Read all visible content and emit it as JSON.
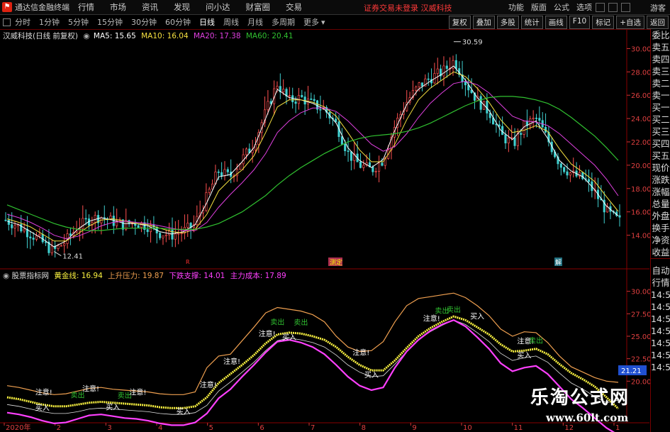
{
  "window": {
    "app_title": "通达信金融终端",
    "guest": "游客"
  },
  "menu": [
    "行情",
    "市场",
    "资讯",
    "发现",
    "问小达",
    "财富圈",
    "交易"
  ],
  "notice": "证券交易未登录  汉威科技",
  "right_menu": [
    "功能",
    "版面",
    "公式",
    "选项"
  ],
  "periods": [
    "分时",
    "1分钟",
    "5分钟",
    "15分钟",
    "30分钟",
    "60分钟",
    "日线",
    "周线",
    "月线",
    "多周期",
    "更多"
  ],
  "active_period": "日线",
  "toolbar_right": [
    "复权",
    "叠加",
    "多股",
    "统计",
    "画线",
    "F10",
    "标记",
    "+自选",
    "返回"
  ],
  "main_legend": {
    "stock": "汉威科技(日线 前复权)",
    "ma5": "MA5: 15.65",
    "ma10": "MA10: 16.04",
    "ma20": "MA20: 17.38",
    "ma60": "MA60: 20.41"
  },
  "main_axis": [
    "30.00",
    "28.00",
    "26.00",
    "24.00",
    "22.00",
    "20.00",
    "18.00",
    "16.00",
    "14.00"
  ],
  "main_annotations": {
    "high": "30.59",
    "low": "12.41"
  },
  "sub_legend": {
    "name": "股票指标网",
    "gold": "黄金线: 16.94",
    "up": "上升压力: 19.87",
    "down": "下跌支撑: 14.01",
    "cost": "主力成本: 17.89"
  },
  "sub_axis": [
    "30.00",
    "27.50",
    "25.00",
    "22.50",
    "20.00"
  ],
  "sub_price_tag": "21.21",
  "signals": {
    "attention": "注意!",
    "buy": "买入",
    "sell": "卖出"
  },
  "date_axis": [
    "2020年",
    "2",
    "3",
    "4",
    "5",
    "6",
    "7",
    "8",
    "9",
    "10",
    "11",
    "12",
    "1"
  ],
  "right_sidebar": [
    "委比",
    "卖五",
    "卖四",
    "卖三",
    "卖二",
    "卖一",
    "买一",
    "买二",
    "买三",
    "买四",
    "买五",
    "现价",
    "涨跌",
    "涨幅",
    "总量",
    "外盘",
    "换手",
    "净资",
    "收益",
    "",
    "自动",
    "行情",
    "14:5",
    "14:5",
    "14:5",
    "14:5",
    "14:5",
    "14:5",
    "14:5"
  ],
  "markers": {
    "r": "R",
    "yellow": "测定",
    "teal": "解"
  },
  "watermark": {
    "cn": "乐淘公式网",
    "url": "www.60lt.com"
  },
  "colors": {
    "ma5": "#ffffff",
    "ma10": "#f5e040",
    "ma20": "#e040e0",
    "ma60": "#30c030",
    "up_candle": "#ff5050",
    "down_candle": "#40d0d0",
    "gold": "#f8f040",
    "pressure": "#f0a050",
    "support": "#ff40ff",
    "cost": "#e0e0e0"
  },
  "chart_data": [
    {
      "type": "candlestick",
      "title": "",
      "ylim": [
        13,
        31
      ],
      "x": [
        "2020年",
        "2",
        "3",
        "4",
        "5",
        "6",
        "7",
        "8",
        "9",
        "10",
        "11",
        "12",
        "1"
      ],
      "close_path": [
        15.3,
        14.8,
        14.2,
        13.5,
        12.6,
        13.4,
        14.6,
        15.3,
        15.6,
        15.2,
        14.9,
        15.1,
        14.8,
        14.2,
        14.0,
        14.3,
        14.9,
        17.2,
        19.5,
        19.0,
        20.5,
        21.8,
        24.5,
        27.0,
        25.5,
        25.8,
        25.2,
        24.8,
        23.5,
        21.0,
        20.0,
        19.6,
        20.5,
        23.5,
        25.5,
        26.8,
        27.5,
        28.0,
        29.0,
        27.0,
        25.5,
        24.5,
        22.5,
        21.8,
        23.5,
        24.0,
        22.0,
        20.0,
        19.2,
        18.8,
        17.5,
        15.9,
        15.2
      ],
      "series": [
        {
          "name": "MA5",
          "values": [
            15.2,
            14.9,
            14.3,
            13.7,
            13.0,
            13.5,
            14.5,
            15.2,
            15.5,
            15.3,
            15.0,
            15.0,
            14.8,
            14.3,
            14.1,
            14.3,
            14.9,
            16.8,
            19.0,
            19.2,
            20.3,
            21.5,
            24.0,
            26.5,
            25.8,
            25.6,
            25.3,
            24.8,
            23.6,
            21.5,
            20.4,
            19.8,
            20.5,
            23.0,
            25.2,
            26.5,
            27.2,
            27.8,
            28.5,
            27.3,
            25.8,
            24.7,
            23.0,
            22.2,
            23.3,
            23.8,
            22.3,
            20.4,
            19.5,
            19.0,
            17.9,
            16.5,
            15.65
          ]
        },
        {
          "name": "MA10",
          "values": [
            15.4,
            15.1,
            14.7,
            14.1,
            13.5,
            13.5,
            14.1,
            14.8,
            15.3,
            15.4,
            15.2,
            15.0,
            14.9,
            14.6,
            14.3,
            14.2,
            14.5,
            15.8,
            17.8,
            18.8,
            19.6,
            20.8,
            22.8,
            25.0,
            25.6,
            25.6,
            25.4,
            25.0,
            24.2,
            22.8,
            21.3,
            20.3,
            20.3,
            21.8,
            23.9,
            25.6,
            26.6,
            27.3,
            28.0,
            27.6,
            26.6,
            25.4,
            23.9,
            22.8,
            23.0,
            23.4,
            22.9,
            21.4,
            20.1,
            19.4,
            18.6,
            17.3,
            16.04
          ]
        },
        {
          "name": "MA20",
          "values": [
            15.8,
            15.5,
            15.1,
            14.6,
            14.0,
            13.7,
            13.9,
            14.3,
            14.8,
            15.1,
            15.2,
            15.1,
            15.0,
            14.8,
            14.6,
            14.4,
            14.4,
            15.1,
            16.4,
            17.5,
            18.5,
            19.6,
            21.0,
            22.8,
            23.8,
            24.5,
            24.9,
            24.9,
            24.6,
            23.8,
            22.8,
            21.8,
            21.2,
            21.6,
            22.7,
            24.1,
            25.3,
            26.2,
            27.0,
            27.2,
            26.9,
            26.2,
            25.2,
            24.2,
            23.8,
            23.7,
            23.4,
            22.7,
            21.8,
            20.9,
            20.0,
            18.8,
            17.38
          ]
        },
        {
          "name": "MA60",
          "values": [
            16.6,
            16.2,
            15.8,
            15.4,
            15.0,
            14.7,
            14.5,
            14.4,
            14.4,
            14.5,
            14.6,
            14.6,
            14.6,
            14.6,
            14.5,
            14.5,
            14.5,
            14.7,
            15.0,
            15.5,
            16.0,
            16.7,
            17.4,
            18.3,
            19.1,
            19.8,
            20.4,
            21.0,
            21.5,
            22.0,
            22.3,
            22.5,
            22.6,
            22.7,
            22.9,
            23.2,
            23.6,
            24.1,
            24.6,
            25.1,
            25.5,
            25.8,
            25.9,
            25.9,
            25.8,
            25.6,
            25.3,
            24.8,
            24.1,
            23.3,
            22.5,
            21.5,
            20.41
          ]
        }
      ]
    },
    {
      "type": "line",
      "title": "股票指标网",
      "ylim": [
        16,
        31
      ],
      "series": [
        {
          "name": "黄金线",
          "values": [
            18.2,
            18.0,
            17.7,
            17.4,
            17.2,
            17.2,
            17.4,
            17.6,
            17.7,
            17.6,
            17.5,
            17.4,
            17.3,
            17.1,
            17.0,
            17.0,
            17.2,
            18.2,
            19.8,
            20.8,
            21.8,
            22.9,
            24.2,
            25.2,
            25.4,
            25.3,
            25.0,
            24.6,
            23.8,
            22.7,
            21.8,
            21.2,
            21.2,
            22.3,
            23.7,
            25.0,
            25.9,
            26.6,
            27.2,
            26.8,
            26.0,
            25.2,
            24.1,
            23.3,
            23.4,
            23.6,
            23.0,
            21.9,
            20.9,
            20.2,
            19.4,
            18.2,
            16.94
          ]
        },
        {
          "name": "上升压力",
          "values": [
            19.5,
            19.3,
            19.0,
            18.7,
            18.5,
            18.6,
            18.9,
            19.2,
            19.3,
            19.1,
            19.0,
            18.9,
            18.8,
            18.6,
            18.5,
            18.5,
            18.8,
            21.5,
            22.8,
            23.0,
            24.5,
            26.0,
            27.6,
            28.2,
            28.0,
            27.8,
            27.4,
            26.6,
            25.0,
            23.8,
            23.3,
            23.4,
            24.4,
            26.6,
            28.4,
            29.2,
            29.4,
            29.6,
            29.8,
            29.3,
            28.4,
            27.3,
            25.8,
            25.0,
            25.5,
            25.4,
            24.3,
            22.8,
            21.6,
            21.0,
            20.4,
            20.0,
            19.87
          ]
        },
        {
          "name": "下跌支撑",
          "values": [
            16.5,
            16.3,
            16.0,
            15.6,
            15.3,
            15.4,
            15.8,
            16.2,
            16.3,
            16.1,
            15.9,
            15.8,
            15.6,
            15.3,
            15.1,
            15.1,
            15.4,
            16.4,
            18.1,
            19.1,
            20.5,
            21.8,
            23.2,
            24.4,
            24.6,
            24.3,
            23.8,
            23.0,
            21.8,
            20.5,
            19.5,
            19.0,
            19.3,
            21.5,
            23.3,
            24.6,
            25.6,
            26.3,
            26.8,
            26.1,
            24.9,
            23.6,
            22.0,
            21.1,
            21.5,
            21.7,
            20.8,
            19.4,
            18.0,
            17.0,
            15.9,
            14.8,
            14.01
          ]
        },
        {
          "name": "主力成本",
          "values": [
            17.4,
            17.2,
            16.9,
            16.6,
            16.4,
            16.4,
            16.6,
            16.9,
            17.0,
            16.9,
            16.8,
            16.7,
            16.6,
            16.4,
            16.3,
            16.3,
            16.5,
            17.3,
            18.9,
            19.9,
            21.0,
            22.1,
            23.4,
            24.5,
            24.8,
            24.6,
            24.3,
            23.8,
            22.9,
            21.8,
            21.0,
            20.5,
            20.6,
            21.9,
            23.3,
            24.6,
            25.5,
            26.2,
            26.8,
            26.3,
            25.4,
            24.4,
            23.1,
            22.3,
            22.6,
            22.8,
            22.1,
            20.9,
            19.8,
            19.1,
            18.3,
            17.6,
            17.89
          ]
        }
      ]
    }
  ]
}
